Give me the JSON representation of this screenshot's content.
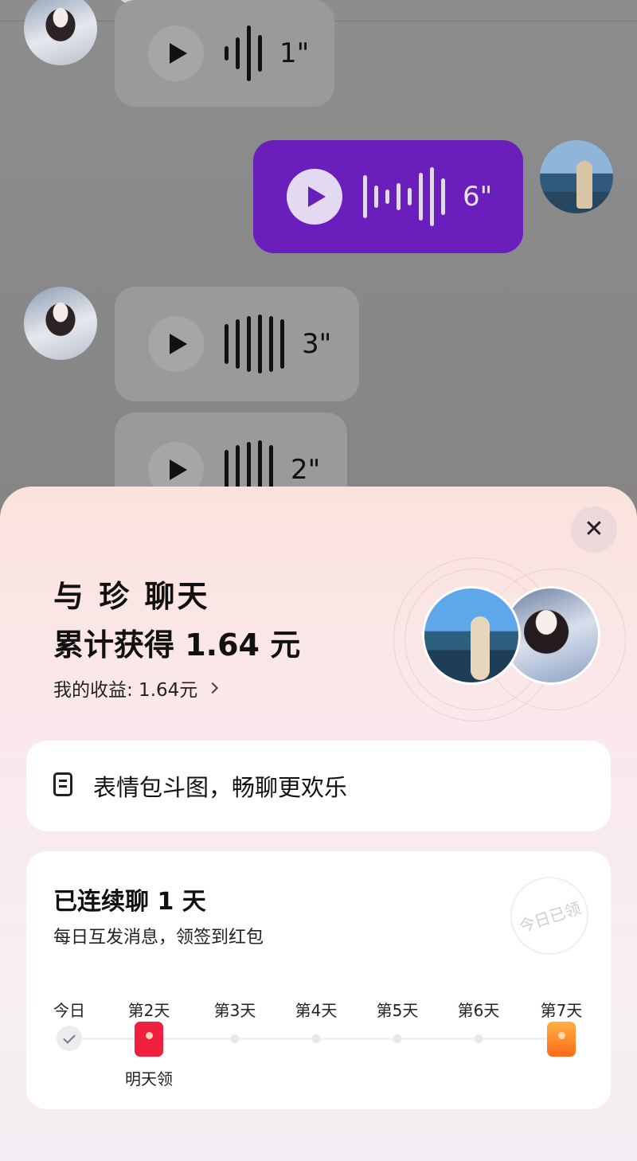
{
  "chat": {
    "messages": [
      {
        "side": "left",
        "duration": "1\""
      },
      {
        "side": "right",
        "duration": "6\""
      },
      {
        "side": "left",
        "duration": "3\""
      },
      {
        "side": "left",
        "duration": "2\""
      }
    ]
  },
  "sheet": {
    "close_icon": "close-icon",
    "title": "与 珍 聊天",
    "earned": "累计获得 1.64 元",
    "my_income": "我的收益: 1.64元",
    "tip_card": {
      "icon": "document-icon",
      "text": "表情包斗图，畅聊更欢乐"
    },
    "streak": {
      "title": "已连续聊 1 天",
      "subtitle": "每日互发消息，领签到红包",
      "stamp": "今日已领",
      "days": [
        {
          "label": "今日",
          "state": "done"
        },
        {
          "label": "第2天",
          "state": "red-packet",
          "note": "明天领"
        },
        {
          "label": "第3天",
          "state": "pending"
        },
        {
          "label": "第4天",
          "state": "pending"
        },
        {
          "label": "第5天",
          "state": "pending"
        },
        {
          "label": "第6天",
          "state": "pending"
        },
        {
          "label": "第7天",
          "state": "gold-packet"
        }
      ]
    }
  },
  "colors": {
    "accent": "#6a1fbc",
    "packet_red": "#f0203e",
    "packet_orange": "#ff8a2a"
  }
}
